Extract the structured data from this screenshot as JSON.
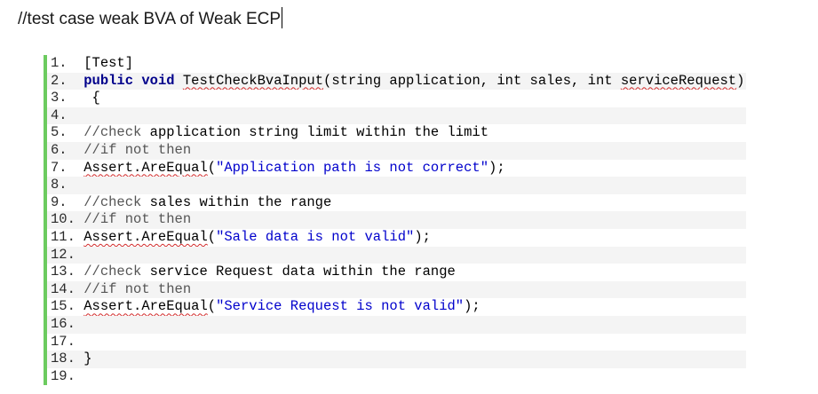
{
  "document": {
    "heading": "//test case weak BVA of Weak ECP"
  },
  "code_lines": [
    {
      "num": "1.",
      "sep": "  ",
      "tokens": [
        {
          "t": "[Test]",
          "k": ""
        }
      ]
    },
    {
      "num": "2.",
      "sep": "  ",
      "tokens": [
        {
          "t": "public",
          "k": "kw"
        },
        {
          "t": " ",
          "k": ""
        },
        {
          "t": "void",
          "k": "kw"
        },
        {
          "t": " ",
          "k": ""
        },
        {
          "t": "TestCheckBvaInput",
          "k": "squiggle"
        },
        {
          "t": "(string application, int sales, int ",
          "k": ""
        },
        {
          "t": "serviceRequest",
          "k": "squiggle"
        },
        {
          "t": ")",
          "k": ""
        }
      ]
    },
    {
      "num": "3.",
      "sep": "   ",
      "tokens": [
        {
          "t": "{",
          "k": ""
        }
      ]
    },
    {
      "num": "4.",
      "sep": "",
      "tokens": []
    },
    {
      "num": "5.",
      "sep": "  ",
      "tokens": [
        {
          "t": "//check",
          "k": "cm"
        },
        {
          "t": " application string limit within the limit",
          "k": ""
        }
      ]
    },
    {
      "num": "6.",
      "sep": "  ",
      "tokens": [
        {
          "t": "//if not then",
          "k": "cm"
        }
      ]
    },
    {
      "num": "7.",
      "sep": "  ",
      "tokens": [
        {
          "t": "Assert.AreEqual",
          "k": "squiggle"
        },
        {
          "t": "(",
          "k": ""
        },
        {
          "t": "\"Application path is not correct\"",
          "k": "str"
        },
        {
          "t": ");",
          "k": ""
        }
      ]
    },
    {
      "num": "8.",
      "sep": "",
      "tokens": []
    },
    {
      "num": "9.",
      "sep": "  ",
      "tokens": [
        {
          "t": "//check",
          "k": "cm"
        },
        {
          "t": " sales within the range",
          "k": ""
        }
      ]
    },
    {
      "num": "10.",
      "sep": " ",
      "tokens": [
        {
          "t": "//if not then",
          "k": "cm"
        }
      ]
    },
    {
      "num": "11.",
      "sep": " ",
      "tokens": [
        {
          "t": "Assert.AreEqual",
          "k": "squiggle"
        },
        {
          "t": "(",
          "k": ""
        },
        {
          "t": "\"Sale data is not valid\"",
          "k": "str"
        },
        {
          "t": ");",
          "k": ""
        }
      ]
    },
    {
      "num": "12.",
      "sep": "",
      "tokens": []
    },
    {
      "num": "13.",
      "sep": " ",
      "tokens": [
        {
          "t": "//check",
          "k": "cm"
        },
        {
          "t": " service Request data within the range",
          "k": ""
        }
      ]
    },
    {
      "num": "14.",
      "sep": " ",
      "tokens": [
        {
          "t": "//if not then",
          "k": "cm"
        }
      ]
    },
    {
      "num": "15.",
      "sep": " ",
      "tokens": [
        {
          "t": "Assert.AreEqual",
          "k": "squiggle"
        },
        {
          "t": "(",
          "k": ""
        },
        {
          "t": "\"Service Request is not valid\"",
          "k": "str"
        },
        {
          "t": ");",
          "k": ""
        }
      ]
    },
    {
      "num": "16.",
      "sep": "",
      "tokens": []
    },
    {
      "num": "17.",
      "sep": "",
      "tokens": []
    },
    {
      "num": "18.",
      "sep": " ",
      "tokens": [
        {
          "t": "}",
          "k": ""
        }
      ]
    },
    {
      "num": "19.",
      "sep": "",
      "tokens": []
    }
  ],
  "colors": {
    "gutter_bar": "#6ccb5f",
    "keyword": "#00008b",
    "string": "#0000cc",
    "spellcheck_squiggle": "#d22a2a"
  }
}
